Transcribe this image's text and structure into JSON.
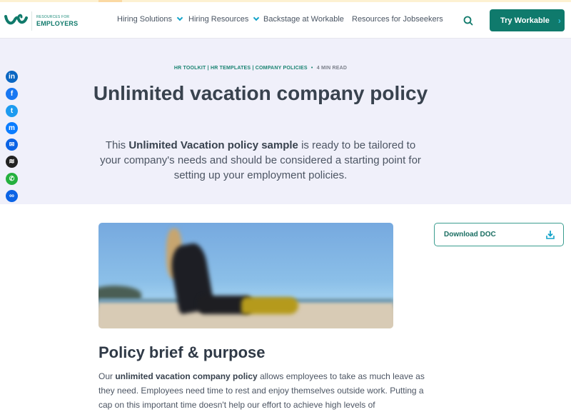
{
  "header": {
    "logo_small": "RESOURCES FOR",
    "logo_big": "EMPLOYERS",
    "nav": [
      {
        "label": "Hiring Solutions",
        "dropdown": true
      },
      {
        "label": "Hiring Resources",
        "dropdown": true
      },
      {
        "label": "Backstage at Workable",
        "dropdown": false
      },
      {
        "label": "Resources for Jobseekers",
        "dropdown": false
      }
    ],
    "search_icon": "search-icon",
    "cta_label": "Try Workable",
    "cta_arrow": "›"
  },
  "colors": {
    "brand": "#0f7a6c",
    "accent": "#13a3c9",
    "hero_bg": "#f0f0fa"
  },
  "breadcrumb": {
    "items": [
      "HR TOOLKIT",
      "HR TEMPLATES",
      "COMPANY POLICIES"
    ],
    "separator": "|",
    "read_time": "4 MIN READ"
  },
  "hero": {
    "title": "Unlimited vacation company policy",
    "lead_prefix": "This ",
    "lead_bold": "Unlimited Vacation policy sample",
    "lead_suffix": " is ready to be tailored to your company's needs and should be considered a starting point for setting up your employment policies."
  },
  "share": [
    {
      "name": "linkedin",
      "glyph": "in",
      "color": "#0a66c2"
    },
    {
      "name": "facebook",
      "glyph": "f",
      "color": "#1877f2"
    },
    {
      "name": "twitter",
      "glyph": "t",
      "color": "#1d9bf0"
    },
    {
      "name": "messenger",
      "glyph": "m",
      "color": "#0a7cff"
    },
    {
      "name": "email",
      "glyph": "✉",
      "color": "#0b63e5"
    },
    {
      "name": "buffer",
      "glyph": "≋",
      "color": "#222222"
    },
    {
      "name": "whatsapp",
      "glyph": "✆",
      "color": "#25b03e"
    },
    {
      "name": "copy-link",
      "glyph": "∞",
      "color": "#0b63e5"
    }
  ],
  "download": {
    "label": "Download DOC"
  },
  "article": {
    "heading": "Policy brief & purpose",
    "p1_prefix": "Our ",
    "p1_bold": "unlimited vacation company policy",
    "p1_suffix": " allows employees to take as much leave as they need. Employees need time to rest and enjoy themselves outside work. Putting a cap on this important time doesn't help our effort to achieve high levels of"
  }
}
